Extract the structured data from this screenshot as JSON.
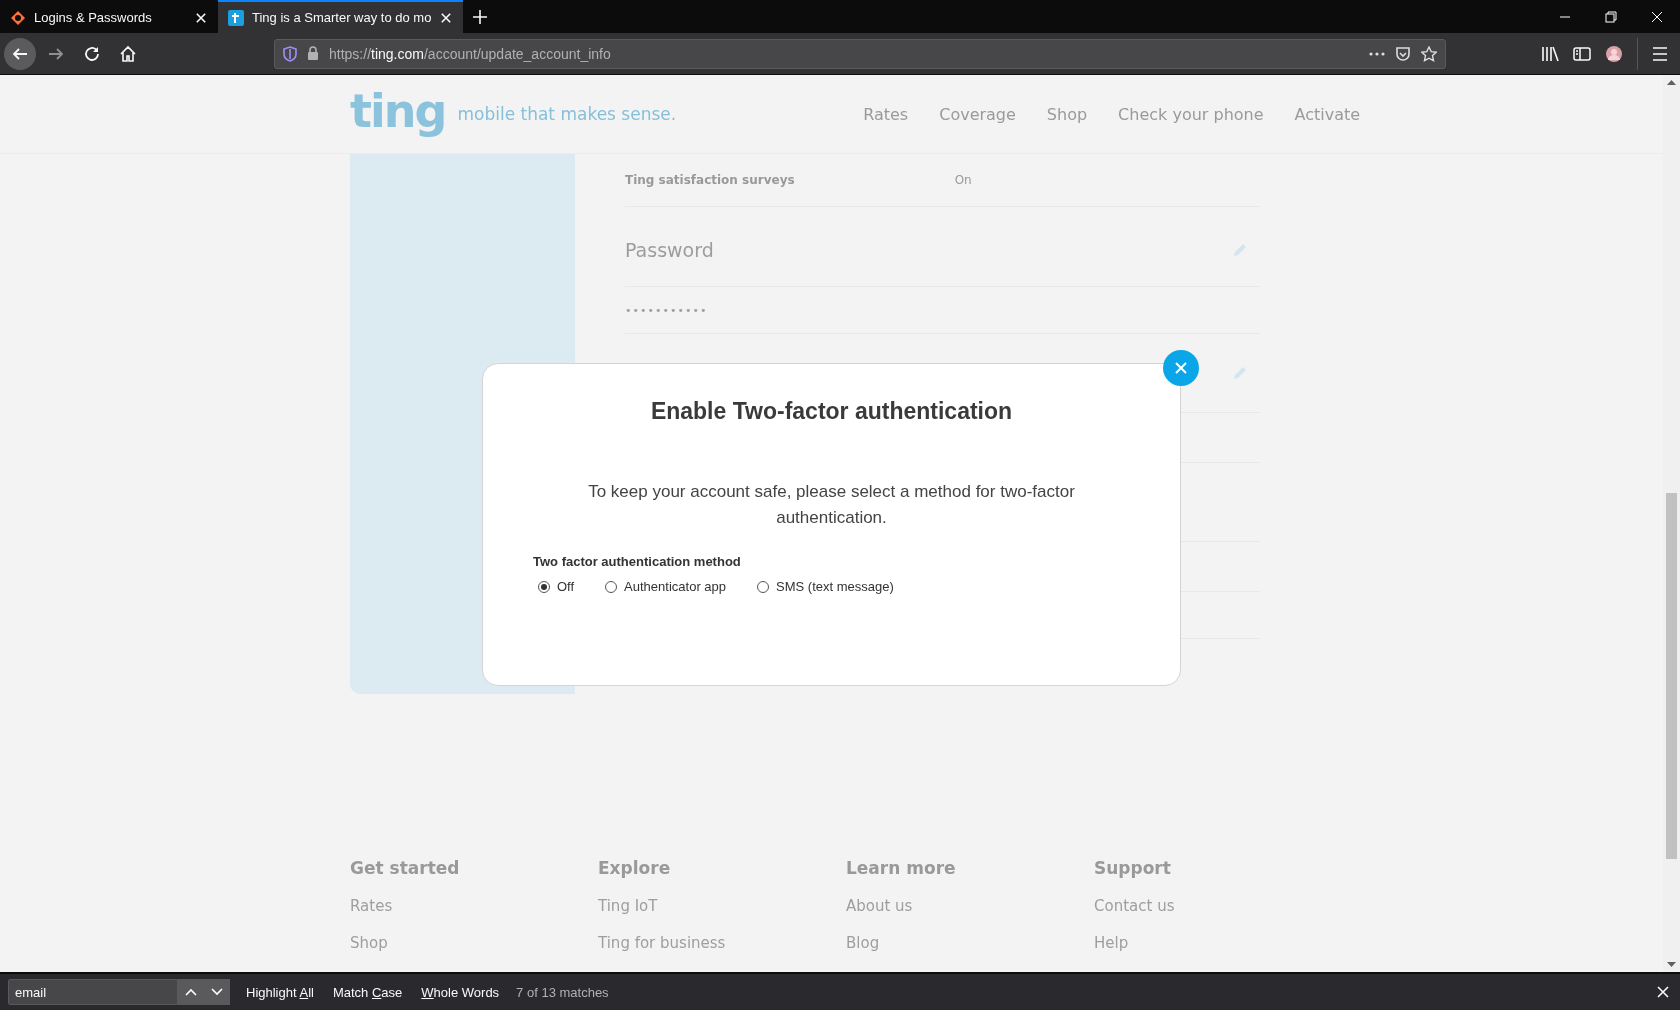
{
  "browser": {
    "tabs": [
      {
        "title": "Logins & Passwords",
        "selected": false
      },
      {
        "title": "Ting is a Smarter way to do mo",
        "selected": true
      }
    ],
    "url": {
      "scheme": "https://",
      "host": "ting.com",
      "path": "/account/update_account_info"
    }
  },
  "site_header": {
    "logo": "ting",
    "tagline": "mobile that makes sense.",
    "nav": [
      "Rates",
      "Coverage",
      "Shop",
      "Check your phone",
      "Activate"
    ]
  },
  "account": {
    "settings": [
      {
        "label": "Ting satisfaction surveys",
        "value": "On"
      }
    ],
    "password": {
      "heading": "Password",
      "value": "•••••••••••"
    }
  },
  "modal": {
    "title": "Enable Two-factor authentication",
    "message": "To keep your account safe, please select a method for two-factor authentication.",
    "field_label": "Two factor authentication method",
    "options": [
      {
        "label": "Off",
        "selected": true
      },
      {
        "label": "Authenticator app",
        "selected": false
      },
      {
        "label": "SMS (text message)",
        "selected": false
      }
    ]
  },
  "footer": {
    "columns": [
      {
        "heading": "Get started",
        "links": [
          "Rates",
          "Shop"
        ]
      },
      {
        "heading": "Explore",
        "links": [
          "Ting IoT",
          "Ting for business"
        ]
      },
      {
        "heading": "Learn more",
        "links": [
          "About us",
          "Blog"
        ]
      },
      {
        "heading": "Support",
        "links": [
          "Contact us",
          "Help"
        ]
      }
    ]
  },
  "find_bar": {
    "query": "email",
    "options": [
      {
        "before": "Highlight ",
        "key": "A",
        "after": "ll"
      },
      {
        "before": "Match ",
        "key": "C",
        "after": "ase"
      },
      {
        "key": "W",
        "after": "hole Words"
      }
    ],
    "status": "7 of 13 matches"
  }
}
